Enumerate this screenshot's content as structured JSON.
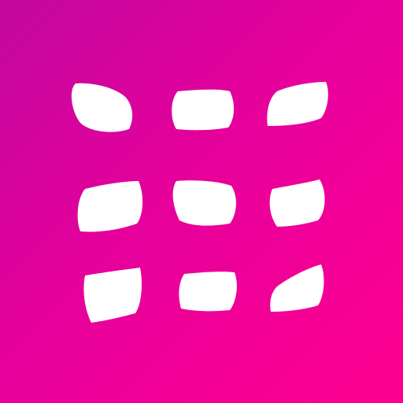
{
  "app_icon": {
    "name": "grid-of-nine-tiles-icon",
    "background_gradient": [
      "#c2089f",
      "#e6009c",
      "#ff0090"
    ],
    "tile_color": "#ffffff",
    "grid": {
      "rows": 3,
      "columns": 3
    }
  }
}
